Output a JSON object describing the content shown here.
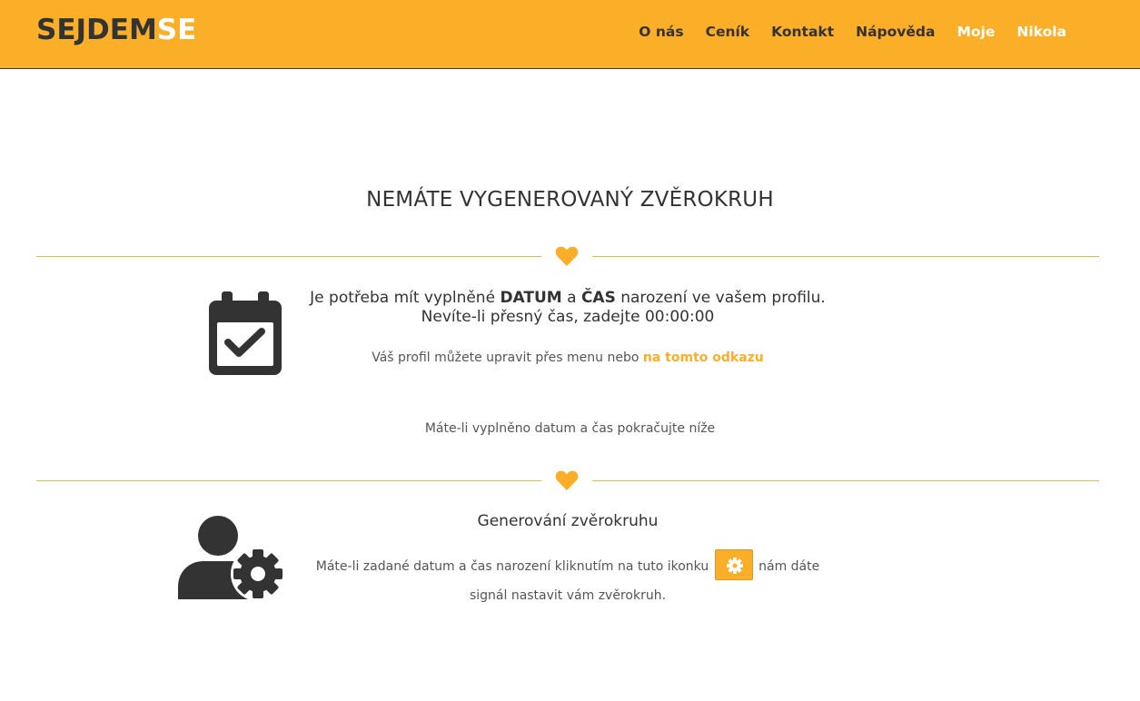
{
  "header": {
    "brand_part1": "SEJDEM",
    "brand_part2": "SE",
    "menu": [
      {
        "label": "O nás"
      },
      {
        "label": "Ceník"
      },
      {
        "label": "Kontakt"
      },
      {
        "label": "Nápověda"
      },
      {
        "label": "Moje"
      },
      {
        "label": "Nikola"
      }
    ]
  },
  "main": {
    "title": "NEMÁTE VYGENEROVANÝ ZVĚROKRUH",
    "section1": {
      "icon": "calendar-check-icon",
      "line_pre": "Je potřeba mít vyplněné ",
      "datum": "DATUM",
      "line_mid": " a ",
      "cas": "ČAS",
      "line_post": " narození ve vašem profilu. Nevíte-li přesný čas, zadejte 00:00:00",
      "profile_text": "Váš profil můžete upravit přes menu nebo ",
      "profile_link": "na tomto odkazu"
    },
    "continue_text": "Máte-li vyplněno datum a čas pokračujte níže",
    "section2": {
      "icon": "user-gear-icon",
      "subtitle": "Generování zvěrokruhu",
      "text_pre": "Máte-li zadané datum a čas narození kliknutím na tuto ikonku ",
      "text_post": " nám dáte signál nastavit vám zvěrokruh."
    },
    "divider_icon": "heart-icon"
  },
  "colors": {
    "accent": "#fbae27",
    "text": "#333333",
    "white": "#ffffff"
  }
}
